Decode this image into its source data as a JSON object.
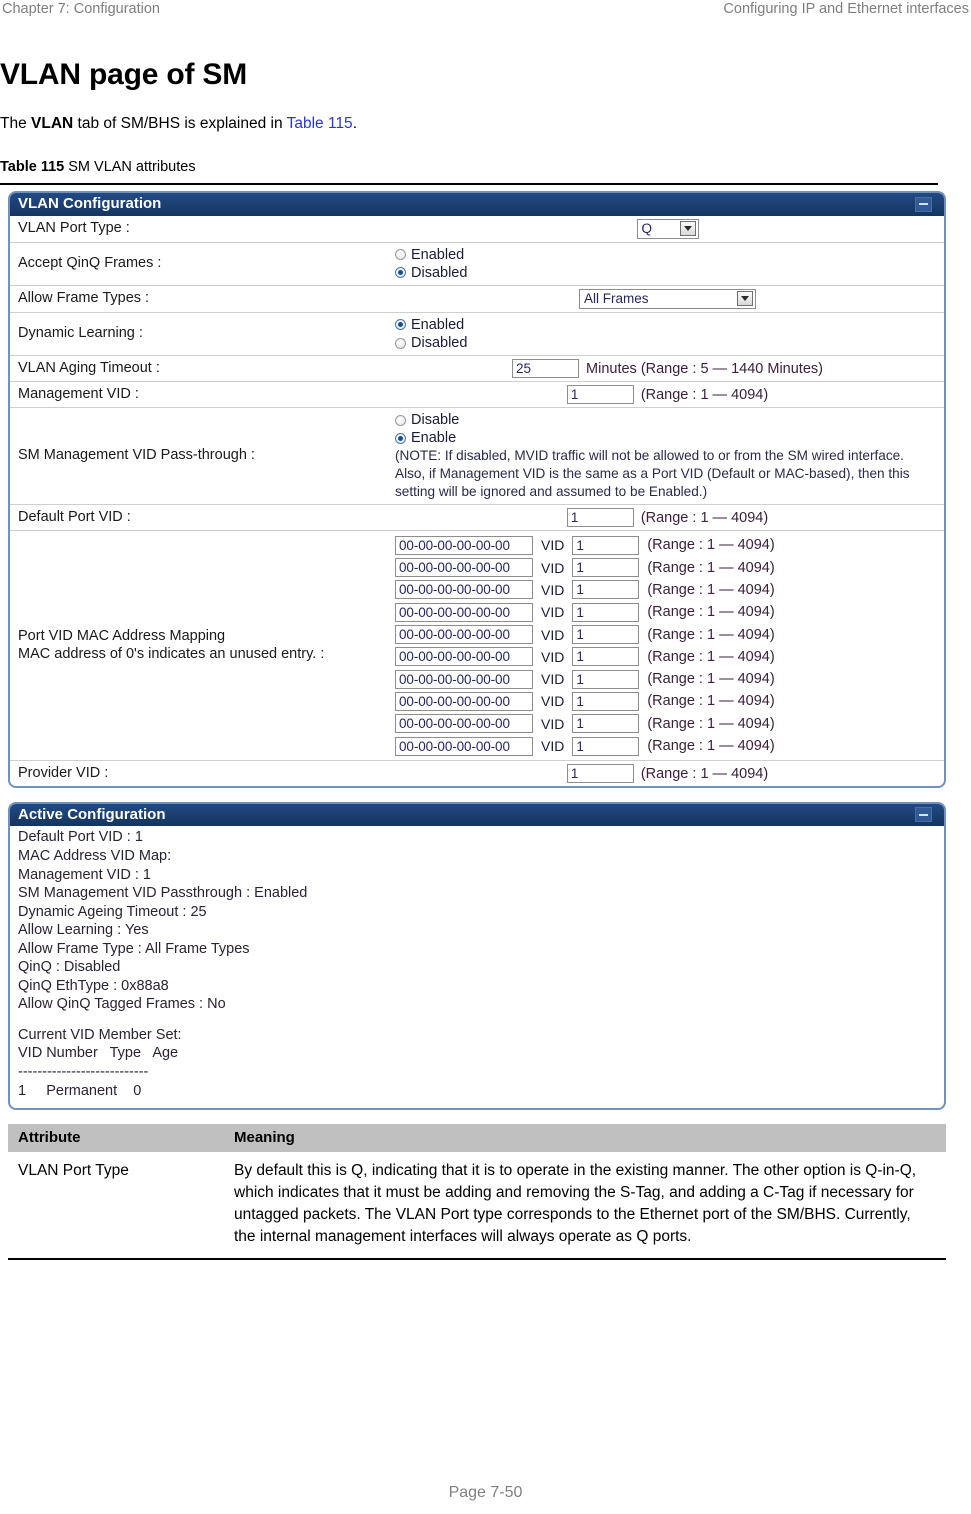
{
  "header": {
    "left": "Chapter 7:  Configuration",
    "right": "Configuring IP and Ethernet interfaces"
  },
  "title": "VLAN page of SM",
  "intro": {
    "before": "The ",
    "bold": "VLAN",
    "middle": " tab of SM/BHS is explained in ",
    "link": "Table 115",
    "after": "."
  },
  "caption": {
    "bold": "Table 115",
    "text": " SM VLAN attributes"
  },
  "screenshot": {
    "vlan_panel": {
      "title": "VLAN Configuration",
      "collapse_icon": "minimize-icon",
      "rows": {
        "vlan_port_type": {
          "label": "VLAN Port Type :",
          "value": "Q"
        },
        "accept_qinq_frames": {
          "label": "Accept QinQ Frames :",
          "option_enabled": "Enabled",
          "option_disabled": "Disabled",
          "selected": "Disabled"
        },
        "allow_frame_types": {
          "label": "Allow Frame Types :",
          "value": "All Frames"
        },
        "dynamic_learning": {
          "label": "Dynamic Learning :",
          "option_enabled": "Enabled",
          "option_disabled": "Disabled",
          "selected": "Enabled"
        },
        "vlan_aging_timeout": {
          "label": "VLAN Aging Timeout :",
          "value": "25",
          "suffix": "Minutes (Range : 5 — 1440 Minutes)"
        },
        "management_vid": {
          "label": "Management VID :",
          "value": "1",
          "suffix": "(Range : 1 — 4094)"
        },
        "sm_mgmt_vid_passthrough": {
          "label": "SM Management VID Pass-through :",
          "option_disable": "Disable",
          "option_enable": "Enable",
          "selected": "Enable",
          "note": "(NOTE: If disabled, MVID traffic will not be allowed to or from the SM wired interface. Also, if Management VID is the same as a Port VID (Default or MAC-based), then this setting will be ignored and assumed to be Enabled.)"
        },
        "default_port_vid": {
          "label": "Default Port VID :",
          "value": "1",
          "suffix": "(Range : 1 — 4094)"
        },
        "port_vid_mac_mapping": {
          "label_line1": "Port VID MAC Address Mapping",
          "label_line2": "MAC address of 0's indicates an unused entry. :",
          "vid_label": "VID",
          "range_text": "(Range : 1 — 4094)",
          "entries": [
            {
              "mac": "00-00-00-00-00-00",
              "vid": "1"
            },
            {
              "mac": "00-00-00-00-00-00",
              "vid": "1"
            },
            {
              "mac": "00-00-00-00-00-00",
              "vid": "1"
            },
            {
              "mac": "00-00-00-00-00-00",
              "vid": "1"
            },
            {
              "mac": "00-00-00-00-00-00",
              "vid": "1"
            },
            {
              "mac": "00-00-00-00-00-00",
              "vid": "1"
            },
            {
              "mac": "00-00-00-00-00-00",
              "vid": "1"
            },
            {
              "mac": "00-00-00-00-00-00",
              "vid": "1"
            },
            {
              "mac": "00-00-00-00-00-00",
              "vid": "1"
            },
            {
              "mac": "00-00-00-00-00-00",
              "vid": "1"
            }
          ]
        },
        "provider_vid": {
          "label": "Provider VID :",
          "value": "1",
          "suffix": "(Range : 1 — 4094)"
        }
      }
    },
    "active_panel": {
      "title": "Active Configuration",
      "collapse_icon": "minimize-icon",
      "lines": [
        "Default Port VID : 1",
        "MAC Address VID Map:",
        "Management VID : 1",
        "SM Management VID Passthrough : Enabled",
        "Dynamic Ageing Timeout : 25",
        "Allow Learning : Yes",
        "Allow Frame Type : All Frame Types",
        "QinQ : Disabled",
        "QinQ EthType : 0x88a8",
        "Allow QinQ Tagged Frames : No",
        "",
        "Current VID Member Set:",
        "VID Number   Type   Age",
        "---------------------------",
        "1     Permanent    0"
      ]
    }
  },
  "attr_table": {
    "headers": {
      "attribute": "Attribute",
      "meaning": "Meaning"
    },
    "rows": [
      {
        "attribute": "VLAN Port Type",
        "meaning": "By default this is Q, indicating that it is to operate in the existing manner. The other option is Q-in-Q, which indicates that it must be adding and removing the S-Tag, and adding a C-Tag if necessary for untagged packets. The VLAN Port type corresponds to the Ethernet port of the SM/BHS. Currently, the internal management interfaces will always operate as Q ports."
      }
    ]
  },
  "footer": {
    "page": "Page 7-50"
  },
  "colors": {
    "panel_title_bg": "#1b3f75",
    "panel_border": "#6f93bd",
    "table_head_bg": "#c0c0c0",
    "link": "#2a34d8",
    "header_text": "#7f7f7f"
  }
}
